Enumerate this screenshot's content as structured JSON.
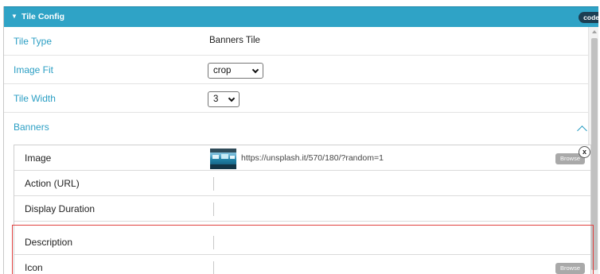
{
  "header": {
    "title": "Tile Config",
    "code_label": "code"
  },
  "fields": {
    "tile_type": {
      "label": "Tile Type",
      "value": "Banners Tile"
    },
    "image_fit": {
      "label": "Image Fit",
      "value": "crop"
    },
    "tile_width": {
      "label": "Tile Width",
      "value": "3"
    }
  },
  "banners": {
    "label": "Banners",
    "rows": {
      "image": {
        "label": "Image",
        "url": "https://unsplash.it/570/180/?random=1",
        "browse": "Browse"
      },
      "action": {
        "label": "Action (URL)"
      },
      "duration": {
        "label": "Display Duration"
      },
      "description": {
        "label": "Description"
      },
      "icon": {
        "label": "Icon",
        "browse": "Browse"
      }
    },
    "close_symbol": "x"
  },
  "colors": {
    "accent": "#2fa3c6",
    "label": "#2c9fc4",
    "highlight": "#e0403f",
    "code_button": "#1c3e52"
  },
  "icons": {
    "header_caret": "caret-down-icon",
    "collapse": "chevron-up-icon",
    "remove": "close-icon"
  }
}
